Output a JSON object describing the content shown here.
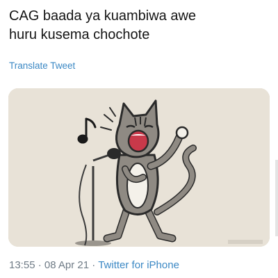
{
  "tweet": {
    "text": "CAG baada ya kuambiwa awe\nhuru kusema chochote",
    "translate_label": "Translate Tweet",
    "time": "13:55",
    "separator": "·",
    "date": "08 Apr 21",
    "source": "Twitter for iPhone"
  },
  "media": {
    "description_icon": "singing-cat-cartoon",
    "music_icon": "music-note-icon",
    "microphone_icon": "microphone-icon"
  },
  "colors": {
    "text": "#141414",
    "link": "#3b88c4",
    "meta": "#6f7b86",
    "media_bg": "#e7e1d6"
  }
}
